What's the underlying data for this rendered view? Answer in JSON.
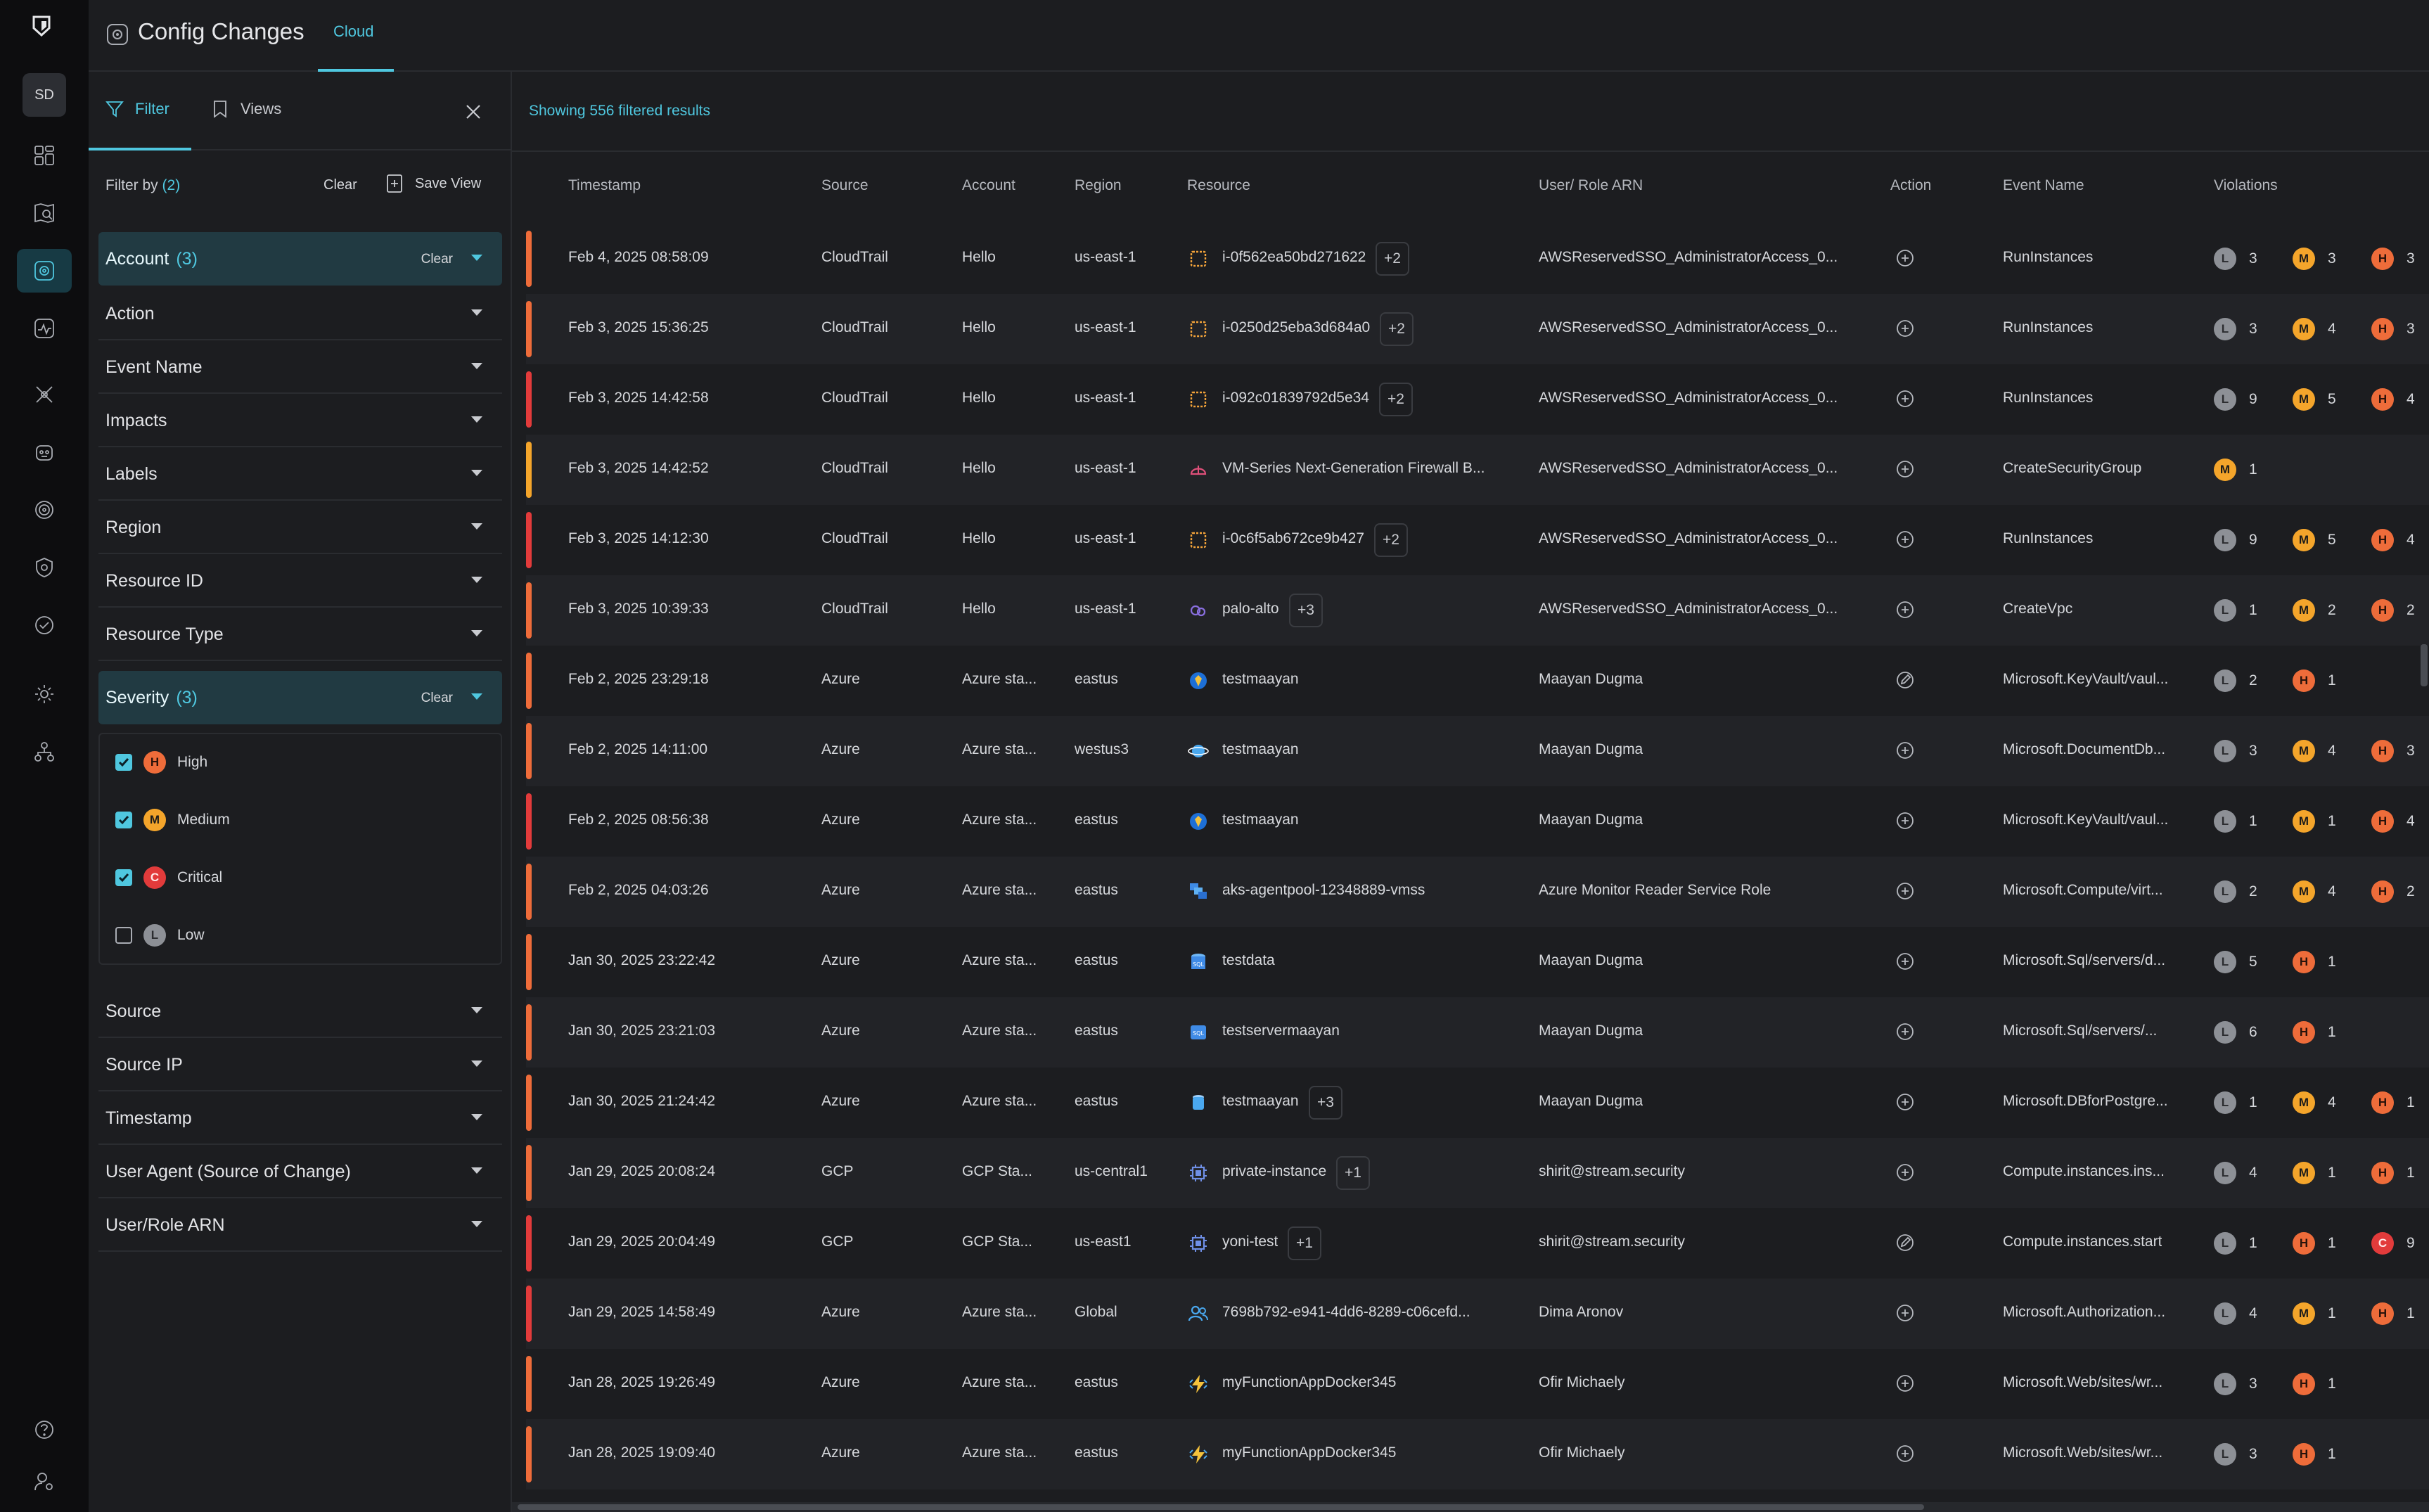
{
  "rail": {
    "avatar": "SD",
    "icons": [
      "dashboard-icon",
      "map-search-icon",
      "config-changes-icon",
      "activity-icon",
      "tools-icon",
      "robot-icon",
      "target-icon",
      "shield-icon",
      "check-circle-icon",
      "settings-icon",
      "org-chart-icon",
      "help-icon",
      "user-settings-icon"
    ]
  },
  "header": {
    "title": "Config Changes",
    "tab": "Cloud"
  },
  "filter_panel": {
    "tab_filter": "Filter",
    "tab_views": "Views",
    "filter_by": "Filter by",
    "filter_by_count": "(2)",
    "clear_all": "Clear",
    "save_view": "Save View",
    "clear": "Clear",
    "facets": [
      {
        "label": "Account",
        "count": "(3)",
        "open": true
      },
      {
        "label": "Action"
      },
      {
        "label": "Event Name"
      },
      {
        "label": "Impacts"
      },
      {
        "label": "Labels"
      },
      {
        "label": "Region"
      },
      {
        "label": "Resource ID"
      },
      {
        "label": "Resource Type"
      },
      {
        "label": "Severity",
        "count": "(3)",
        "open": true
      },
      {
        "label": "Source"
      },
      {
        "label": "Source IP"
      },
      {
        "label": "Timestamp"
      },
      {
        "label": "User Agent (Source of Change)"
      },
      {
        "label": "User/Role ARN"
      }
    ],
    "severity_options": [
      {
        "letter": "H",
        "label": "High",
        "checked": true
      },
      {
        "letter": "M",
        "label": "Medium",
        "checked": true
      },
      {
        "letter": "C",
        "label": "Critical",
        "checked": true
      },
      {
        "letter": "L",
        "label": "Low",
        "checked": false
      }
    ]
  },
  "table": {
    "results_text": "Showing 556 filtered results",
    "columns": [
      "Timestamp",
      "Source",
      "Account",
      "Region",
      "Resource",
      "User/ Role ARN",
      "Action",
      "Event Name",
      "Violations"
    ],
    "colors": {
      "orange": "#ee6c3a",
      "red": "#e23b3b",
      "amber": "#f4a52b"
    },
    "rows": [
      {
        "bar": "orange",
        "ts": "Feb 4, 2025 08:58:09",
        "source": "CloudTrail",
        "account": "Hello",
        "region": "us-east-1",
        "res_icon": "ec2-instance-icon",
        "resource": "i-0f562ea50bd271622",
        "plus": "+2",
        "user": "AWSReservedSSO_AdministratorAccess_0...",
        "action": "plus-circle-icon",
        "event": "RunInstances",
        "viol": [
          [
            "L",
            "3"
          ],
          [
            "M",
            "3"
          ],
          [
            "H",
            "3"
          ]
        ]
      },
      {
        "bar": "orange",
        "ts": "Feb 3, 2025 15:36:25",
        "source": "CloudTrail",
        "account": "Hello",
        "region": "us-east-1",
        "res_icon": "ec2-instance-icon",
        "resource": "i-0250d25eba3d684a0",
        "plus": "+2",
        "user": "AWSReservedSSO_AdministratorAccess_0...",
        "action": "plus-circle-icon",
        "event": "RunInstances",
        "viol": [
          [
            "L",
            "3"
          ],
          [
            "M",
            "4"
          ],
          [
            "H",
            "3"
          ]
        ]
      },
      {
        "bar": "red",
        "ts": "Feb 3, 2025 14:42:58",
        "source": "CloudTrail",
        "account": "Hello",
        "region": "us-east-1",
        "res_icon": "ec2-instance-icon",
        "resource": "i-092c01839792d5e34",
        "plus": "+2",
        "user": "AWSReservedSSO_AdministratorAccess_0...",
        "action": "plus-circle-icon",
        "event": "RunInstances",
        "viol": [
          [
            "L",
            "9"
          ],
          [
            "M",
            "5"
          ],
          [
            "H",
            "4"
          ]
        ]
      },
      {
        "bar": "amber",
        "ts": "Feb 3, 2025 14:42:52",
        "source": "CloudTrail",
        "account": "Hello",
        "region": "us-east-1",
        "res_icon": "firewall-icon",
        "resource": "VM-Series Next-Generation Firewall B...",
        "plus": "",
        "user": "AWSReservedSSO_AdministratorAccess_0...",
        "action": "plus-circle-icon",
        "event": "CreateSecurityGroup",
        "viol": [
          [
            "M",
            "1"
          ]
        ]
      },
      {
        "bar": "red",
        "ts": "Feb 3, 2025 14:12:30",
        "source": "CloudTrail",
        "account": "Hello",
        "region": "us-east-1",
        "res_icon": "ec2-instance-icon",
        "resource": "i-0c6f5ab672ce9b427",
        "plus": "+2",
        "user": "AWSReservedSSO_AdministratorAccess_0...",
        "action": "plus-circle-icon",
        "event": "RunInstances",
        "viol": [
          [
            "L",
            "9"
          ],
          [
            "M",
            "5"
          ],
          [
            "H",
            "4"
          ]
        ]
      },
      {
        "bar": "orange",
        "ts": "Feb 3, 2025 10:39:33",
        "source": "CloudTrail",
        "account": "Hello",
        "region": "us-east-1",
        "res_icon": "vpc-icon",
        "resource": "palo-alto",
        "plus": "+3",
        "user": "AWSReservedSSO_AdministratorAccess_0...",
        "action": "plus-circle-icon",
        "event": "CreateVpc",
        "viol": [
          [
            "L",
            "1"
          ],
          [
            "M",
            "2"
          ],
          [
            "H",
            "2"
          ]
        ]
      },
      {
        "bar": "orange",
        "ts": "Feb 2, 2025 23:29:18",
        "source": "Azure",
        "account": "Azure sta...",
        "region": "eastus",
        "res_icon": "key-vault-icon",
        "resource": "testmaayan",
        "plus": "",
        "user": "Maayan Dugma",
        "action": "edit-circle-icon",
        "event": "Microsoft.KeyVault/vaul...",
        "viol": [
          [
            "L",
            "2"
          ],
          [
            "H",
            "1"
          ]
        ]
      },
      {
        "bar": "orange",
        "ts": "Feb 2, 2025 14:11:00",
        "source": "Azure",
        "account": "Azure sta...",
        "region": "westus3",
        "res_icon": "cosmos-db-icon",
        "resource": "testmaayan",
        "plus": "",
        "user": "Maayan Dugma",
        "action": "plus-circle-icon",
        "event": "Microsoft.DocumentDb...",
        "viol": [
          [
            "L",
            "3"
          ],
          [
            "M",
            "4"
          ],
          [
            "H",
            "3"
          ]
        ]
      },
      {
        "bar": "red",
        "ts": "Feb 2, 2025 08:56:38",
        "source": "Azure",
        "account": "Azure sta...",
        "region": "eastus",
        "res_icon": "key-vault-icon",
        "resource": "testmaayan",
        "plus": "",
        "user": "Maayan Dugma",
        "action": "plus-circle-icon",
        "event": "Microsoft.KeyVault/vaul...",
        "viol": [
          [
            "L",
            "1"
          ],
          [
            "M",
            "1"
          ],
          [
            "H",
            "4"
          ]
        ]
      },
      {
        "bar": "orange",
        "ts": "Feb 2, 2025 04:03:26",
        "source": "Azure",
        "account": "Azure sta...",
        "region": "eastus",
        "res_icon": "vmss-icon",
        "resource": "aks-agentpool-12348889-vmss",
        "plus": "",
        "user": "Azure Monitor Reader Service Role",
        "action": "plus-circle-icon",
        "event": "Microsoft.Compute/virt...",
        "viol": [
          [
            "L",
            "2"
          ],
          [
            "M",
            "4"
          ],
          [
            "H",
            "2"
          ]
        ]
      },
      {
        "bar": "orange",
        "ts": "Jan 30, 2025 23:22:42",
        "source": "Azure",
        "account": "Azure sta...",
        "region": "eastus",
        "res_icon": "sql-database-icon",
        "resource": "testdata",
        "plus": "",
        "user": "Maayan Dugma",
        "action": "plus-circle-icon",
        "event": "Microsoft.Sql/servers/d...",
        "viol": [
          [
            "L",
            "5"
          ],
          [
            "H",
            "1"
          ]
        ]
      },
      {
        "bar": "orange",
        "ts": "Jan 30, 2025 23:21:03",
        "source": "Azure",
        "account": "Azure sta...",
        "region": "eastus",
        "res_icon": "sql-server-icon",
        "resource": "testservermaayan",
        "plus": "",
        "user": "Maayan Dugma",
        "action": "plus-circle-icon",
        "event": "Microsoft.Sql/servers/...",
        "viol": [
          [
            "L",
            "6"
          ],
          [
            "H",
            "1"
          ]
        ]
      },
      {
        "bar": "orange",
        "ts": "Jan 30, 2025 21:24:42",
        "source": "Azure",
        "account": "Azure sta...",
        "region": "eastus",
        "res_icon": "postgres-icon",
        "resource": "testmaayan",
        "plus": "+3",
        "user": "Maayan Dugma",
        "action": "plus-circle-icon",
        "event": "Microsoft.DBforPostgre...",
        "viol": [
          [
            "L",
            "1"
          ],
          [
            "M",
            "4"
          ],
          [
            "H",
            "1"
          ]
        ]
      },
      {
        "bar": "orange",
        "ts": "Jan 29, 2025 20:08:24",
        "source": "GCP",
        "account": "GCP Sta...",
        "region": "us-central1",
        "res_icon": "compute-instance-icon",
        "resource": "private-instance",
        "plus": "+1",
        "user": "shirit@stream.security",
        "action": "plus-circle-icon",
        "event": "Compute.instances.ins...",
        "viol": [
          [
            "L",
            "4"
          ],
          [
            "M",
            "1"
          ],
          [
            "H",
            "1"
          ]
        ]
      },
      {
        "bar": "red",
        "ts": "Jan 29, 2025 20:04:49",
        "source": "GCP",
        "account": "GCP Sta...",
        "region": "us-east1",
        "res_icon": "compute-instance-icon",
        "resource": "yoni-test",
        "plus": "+1",
        "user": "shirit@stream.security",
        "action": "edit-circle-icon",
        "event": "Compute.instances.start",
        "viol": [
          [
            "L",
            "1"
          ],
          [
            "H",
            "1"
          ],
          [
            "C",
            "9"
          ]
        ]
      },
      {
        "bar": "red",
        "ts": "Jan 29, 2025 14:58:49",
        "source": "Azure",
        "account": "Azure sta...",
        "region": "Global",
        "res_icon": "users-icon",
        "resource": "7698b792-e941-4dd6-8289-c06cefd...",
        "plus": "",
        "user": "Dima Aronov",
        "action": "plus-circle-icon",
        "event": "Microsoft.Authorization...",
        "viol": [
          [
            "L",
            "4"
          ],
          [
            "M",
            "1"
          ],
          [
            "H",
            "1"
          ]
        ]
      },
      {
        "bar": "orange",
        "ts": "Jan 28, 2025 19:26:49",
        "source": "Azure",
        "account": "Azure sta...",
        "region": "eastus",
        "res_icon": "function-app-icon",
        "resource": "myFunctionAppDocker345",
        "plus": "",
        "user": "Ofir Michaely",
        "action": "plus-circle-icon",
        "event": "Microsoft.Web/sites/wr...",
        "viol": [
          [
            "L",
            "3"
          ],
          [
            "H",
            "1"
          ]
        ]
      },
      {
        "bar": "orange",
        "ts": "Jan 28, 2025 19:09:40",
        "source": "Azure",
        "account": "Azure sta...",
        "region": "eastus",
        "res_icon": "function-app-icon",
        "resource": "myFunctionAppDocker345",
        "plus": "",
        "user": "Ofir Michaely",
        "action": "plus-circle-icon",
        "event": "Microsoft.Web/sites/wr...",
        "viol": [
          [
            "L",
            "3"
          ],
          [
            "H",
            "1"
          ]
        ]
      }
    ]
  }
}
